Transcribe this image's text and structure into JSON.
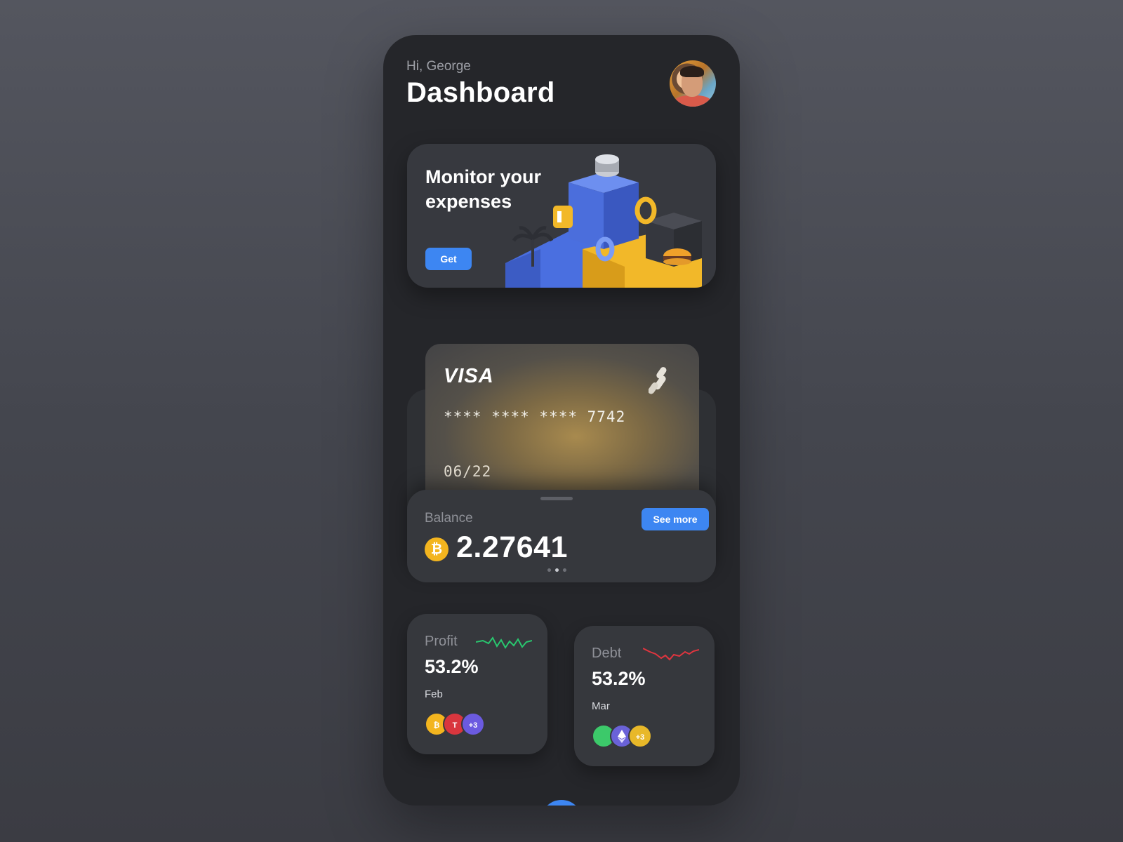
{
  "header": {
    "greeting": "Hi, George",
    "title": "Dashboard"
  },
  "promo": {
    "title": "Monitor your expenses",
    "button_label": "Get"
  },
  "card": {
    "brand": "VISA",
    "number": "**** **** **** 7742",
    "expiry": "06/22"
  },
  "balance": {
    "label": "Balance",
    "value": "2.27641",
    "currency_symbol": "₿",
    "see_more_label": "See more",
    "pager": {
      "count": 3,
      "active_index": 1
    }
  },
  "stats": {
    "profit": {
      "label": "Profit",
      "value": "53.2%",
      "month": "Feb",
      "trend_color": "#29c76f",
      "coins": [
        {
          "icon": "bitcoin-icon",
          "symbol": "₿",
          "color": "#f3b51f"
        },
        {
          "icon": "tesla-icon",
          "symbol": "T",
          "color": "#d9363e"
        },
        {
          "icon": "more-icon",
          "symbol": "+3",
          "color": "#6b5ae0"
        }
      ]
    },
    "debt": {
      "label": "Debt",
      "value": "53.2%",
      "month": "Mar",
      "trend_color": "#e0353f",
      "coins": [
        {
          "icon": "green-token-icon",
          "symbol": "",
          "color": "#3cc96a"
        },
        {
          "icon": "ethereum-icon",
          "symbol": "",
          "color": "#6a62d8"
        },
        {
          "icon": "more-icon",
          "symbol": "+3",
          "color": "#e8b829"
        }
      ]
    }
  },
  "colors": {
    "accent": "#3d86f2",
    "background": "#25262a",
    "card_surface": "#36383d"
  }
}
